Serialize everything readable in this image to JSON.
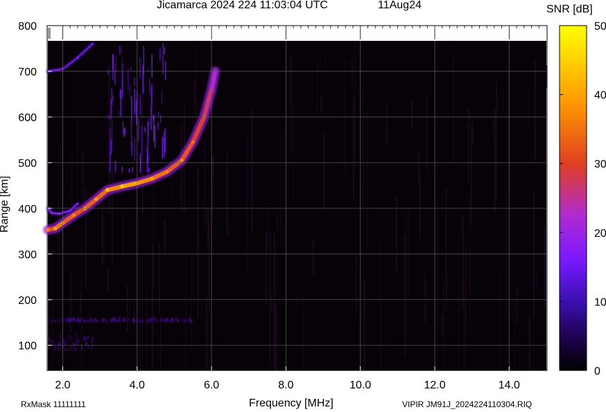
{
  "header": {
    "title": "Jicamarca 2024 224 11:03:04 UTC",
    "date": "11Aug24"
  },
  "footer": {
    "rx_mask": "RxMask 11111111",
    "filename": "VIPIR  JM91J_2024224110304.RIQ"
  },
  "colorbar": {
    "title": "SNR [dB]",
    "ticks": [
      0,
      10,
      20,
      30,
      40,
      50
    ],
    "range": [
      0,
      50
    ],
    "colors": [
      "#000000",
      "#3a0080",
      "#7a19ff",
      "#b02ad0",
      "#e04020",
      "#ff9a00",
      "#ffff00"
    ]
  },
  "chart_data": {
    "type": "heatmap",
    "title": "Jicamarca 2024 224 11:03:04 UTC",
    "xlabel": "Frequency [MHz]",
    "ylabel": "Range [km]",
    "xlim": [
      1.6,
      15.0
    ],
    "ylim": [
      45,
      800
    ],
    "x_ticks": [
      "2.0",
      "4.0",
      "6.0",
      "8.0",
      "10.0",
      "12.0",
      "14.0"
    ],
    "y_ticks": [
      "100",
      "200",
      "300",
      "400",
      "500",
      "600",
      "700",
      "800"
    ],
    "grid": true,
    "value_label": "SNR [dB]",
    "echo_traces": [
      {
        "name": "",
        "x": [
          1.6,
          1.8,
          2.0,
          2.3,
          2.6,
          2.9,
          3.2,
          3.6,
          4.0,
          4.4,
          4.8,
          5.2,
          5.5,
          5.8,
          6.0,
          6.1
        ],
        "y": [
          353,
          356,
          368,
          385,
          400,
          420,
          440,
          448,
          455,
          465,
          480,
          505,
          545,
          600,
          660,
          700
        ],
        "snr": [
          35,
          38,
          36,
          35,
          36,
          37,
          40,
          42,
          40,
          38,
          36,
          35,
          33,
          30,
          25,
          20
        ]
      },
      {
        "name": "",
        "x": [
          1.6,
          1.7,
          1.9,
          2.2,
          2.4
        ],
        "y": [
          400,
          390,
          388,
          395,
          410
        ],
        "snr": [
          16,
          16,
          16,
          15,
          14
        ]
      },
      {
        "name": "",
        "x": [
          1.6,
          2.0,
          2.4,
          2.8
        ],
        "y": [
          700,
          705,
          730,
          760
        ],
        "snr": [
          15,
          14,
          14,
          13
        ]
      }
    ],
    "diffuse_regions": [
      {
        "x": [
          3.2,
          4.8
        ],
        "y": [
          480,
          765
        ],
        "snr": 15
      },
      {
        "x": [
          1.6,
          2.8
        ],
        "y": [
          90,
          125
        ],
        "snr": 10
      },
      {
        "x": [
          1.6,
          5.5
        ],
        "y": [
          152,
          162
        ],
        "snr": 9
      }
    ]
  }
}
